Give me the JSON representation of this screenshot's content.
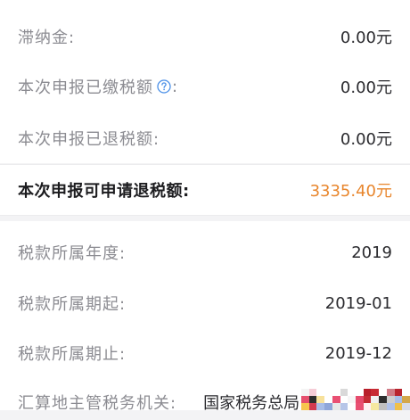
{
  "rows_top": [
    {
      "label": "滞纳金:",
      "value": "0.00元"
    },
    {
      "label": "本次申报已缴税额",
      "label_suffix": ":",
      "has_help": true,
      "value": "0.00元"
    },
    {
      "label": "本次申报已退税额:",
      "value": "0.00元"
    }
  ],
  "highlight": {
    "label": "本次申报可申请退税额:",
    "value": "3335.40元",
    "value_color": "#e8862d"
  },
  "rows_bottom": [
    {
      "label": "税款所属年度:",
      "value": "2019"
    },
    {
      "label": "税款所属期起:",
      "value": "2019-01"
    },
    {
      "label": "税款所属期止:",
      "value": "2019-12"
    },
    {
      "label": "汇算地主管税务机关:",
      "value": "国家税务总局"
    }
  ],
  "icons": {
    "help": "question-circle-icon"
  },
  "colors": {
    "accent": "#e8862d",
    "background": "#f3f3f5",
    "help_icon": "#4a8fe7"
  }
}
